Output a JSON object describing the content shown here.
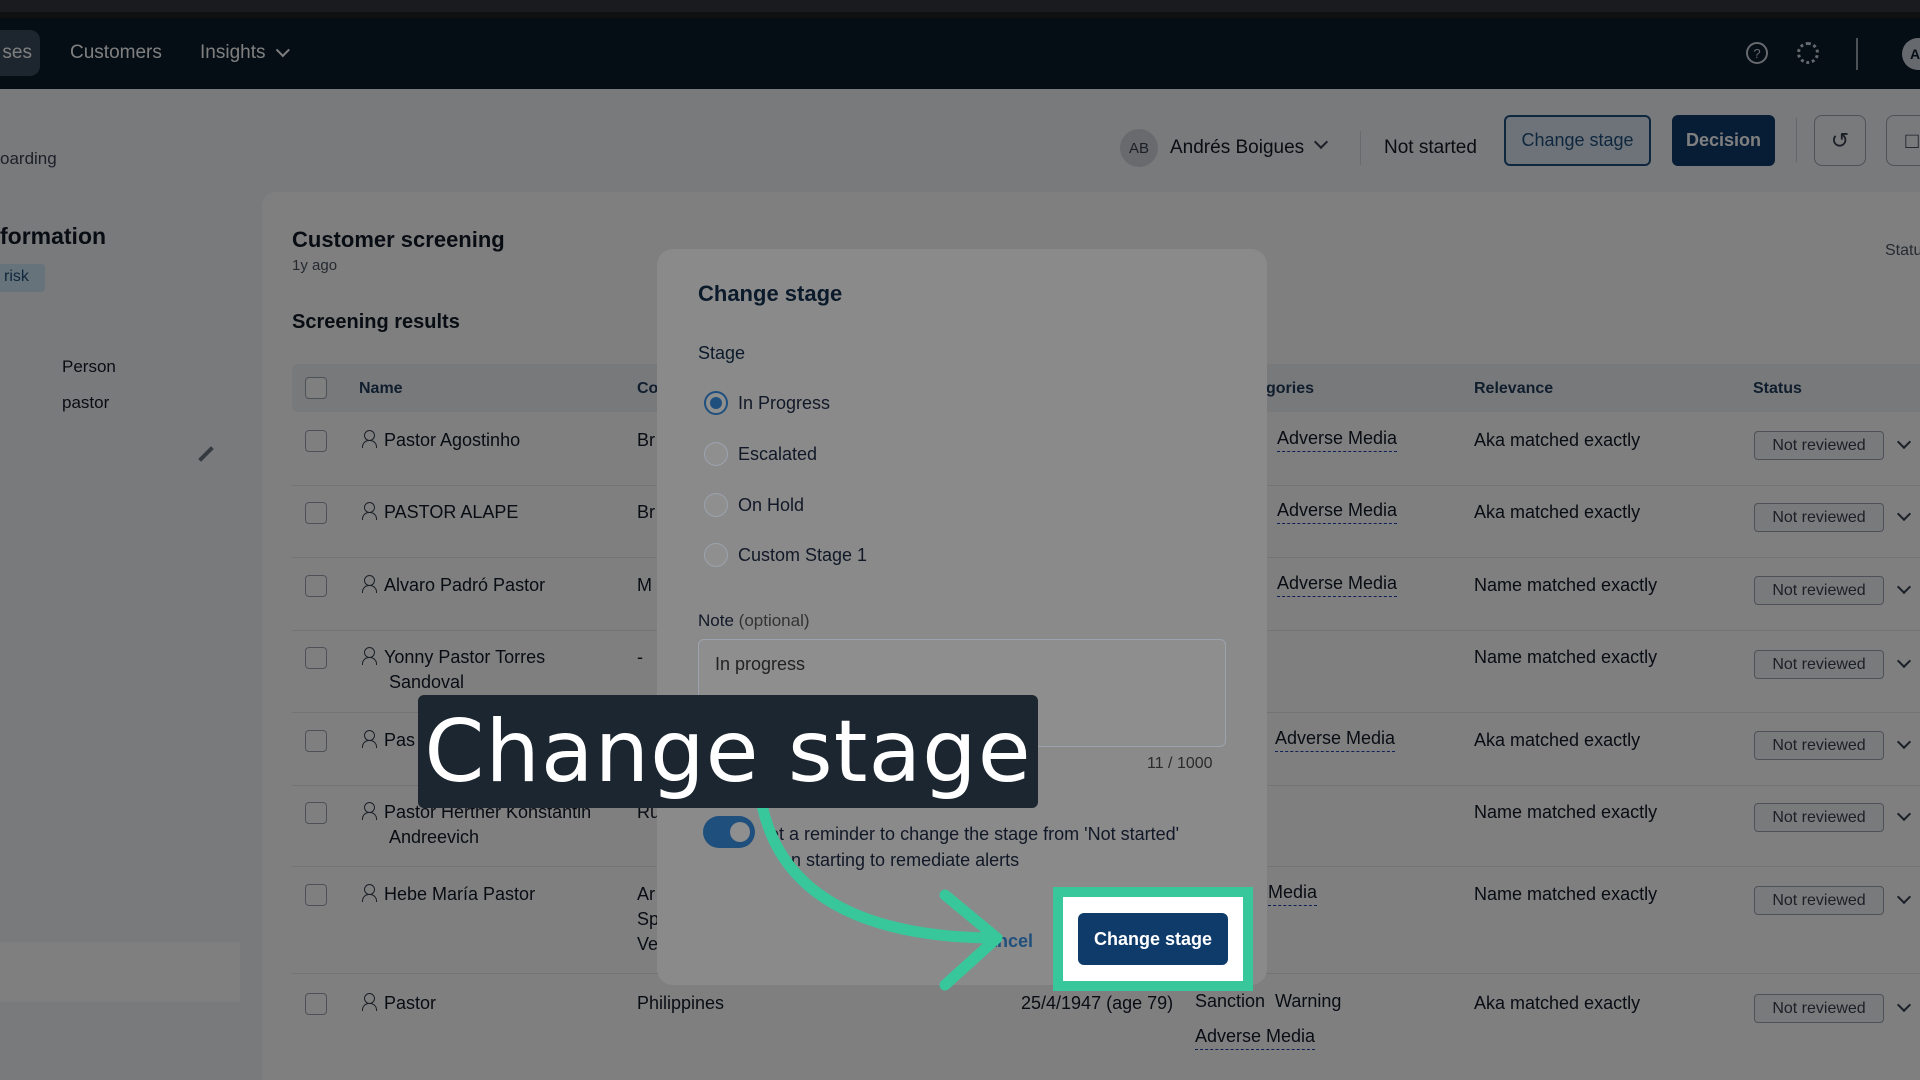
{
  "nav": {
    "active_tab": "ses",
    "links": [
      "Customers",
      "Insights"
    ],
    "avatar": "Al"
  },
  "page": {
    "breadcrumb": "oarding",
    "section_title": "formation",
    "risk_tag": "risk",
    "info": [
      "Person",
      "pastor"
    ]
  },
  "header": {
    "owner_initials": "AB",
    "owner_name": "Andrés Boigues",
    "stage": "Not started",
    "change_stage": "Change stage",
    "decision": "Decision"
  },
  "card": {
    "title": "Customer screening",
    "subtitle": "1y ago",
    "status_label": "Statu",
    "results_title": "Screening results",
    "columns": [
      "Name",
      "Co",
      "gories",
      "Relevance",
      "Status"
    ]
  },
  "rows": [
    {
      "name": "Pastor Agostinho",
      "country": "Br",
      "category": "Adverse Media",
      "relevance": "Aka matched exactly",
      "status": "Not reviewed"
    },
    {
      "name": "PASTOR ALAPE",
      "country": "Br",
      "category": "Adverse Media",
      "relevance": "Aka matched exactly",
      "status": "Not reviewed"
    },
    {
      "name": "Alvaro Padró Pastor",
      "country": "M",
      "category": "Adverse Media",
      "relevance": "Name matched exactly",
      "status": "Not reviewed"
    },
    {
      "name": "Yonny Pastor Torres",
      "name2": "Sandoval",
      "country": "-",
      "category": "",
      "relevance": "Name matched exactly",
      "status": "Not reviewed"
    },
    {
      "name": "Pas",
      "country": "",
      "category": "Adverse Media",
      "relevance": "Aka matched exactly",
      "status": "Not reviewed"
    },
    {
      "name": "Pastor Herther Konstantin",
      "name2": "Andreevich",
      "country": "Ru",
      "category": "",
      "relevance": "Name matched exactly",
      "status": "Not reviewed"
    },
    {
      "name": "Hebe María Pastor",
      "country": "Ar",
      "country2": "Sp",
      "country3": "Ve",
      "category": "Media",
      "relevance": "Name matched exactly",
      "status": "Not reviewed"
    },
    {
      "name": "Pastor",
      "country": "Philippines",
      "dob": "25/4/1947 (age 79)",
      "category": "Sanction  Warning",
      "category2": "Adverse Media",
      "relevance": "Aka matched exactly",
      "status": "Not reviewed"
    }
  ],
  "modal": {
    "title": "Change stage",
    "stage_label": "Stage",
    "options": [
      "In Progress",
      "Escalated",
      "On Hold",
      "Custom Stage 1"
    ],
    "selected": "In Progress",
    "note_label": "Note",
    "note_optional": "(optional)",
    "note_value": "In progress",
    "char_count": "11 / 1000",
    "toggle_text": "et a reminder to change the stage from 'Not started'",
    "toggle_text2": "en starting to remediate alerts",
    "cancel": "ancel",
    "confirm": "Change stage"
  },
  "caption": "Change stage",
  "colors": {
    "nav": "#0b1a2b",
    "primary": "#0f3b6b",
    "highlight": "#38c79a"
  }
}
